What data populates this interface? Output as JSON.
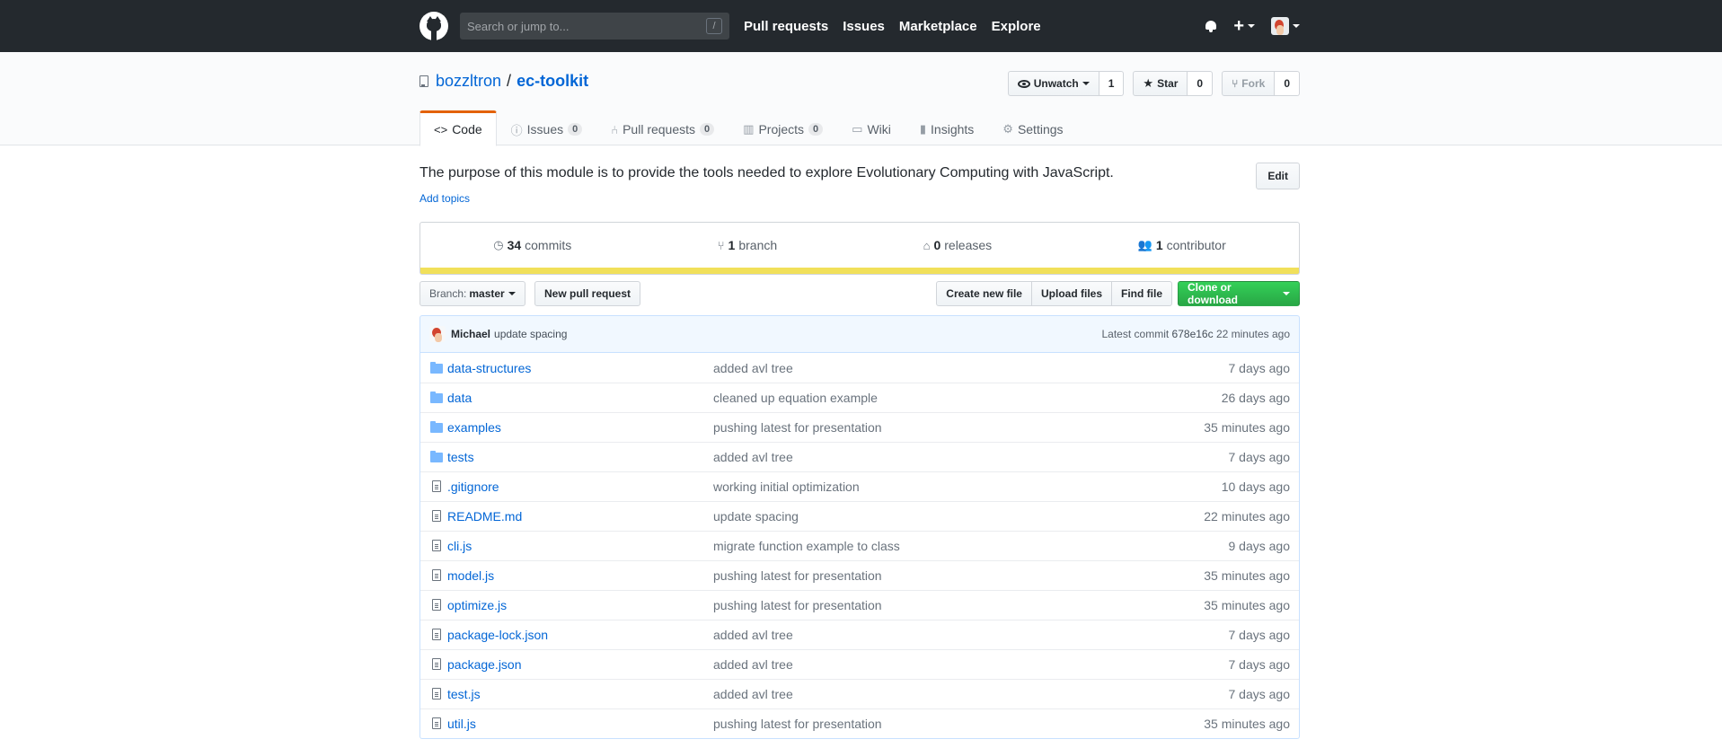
{
  "header": {
    "search_placeholder": "Search or jump to...",
    "search_shortcut": "/",
    "nav": [
      "Pull requests",
      "Issues",
      "Marketplace",
      "Explore"
    ],
    "plus_label": "+"
  },
  "repo": {
    "owner": "bozzltron",
    "separator": "/",
    "name": "ec-toolkit",
    "watch_label": "Unwatch",
    "watch_count": "1",
    "star_label": "Star",
    "star_count": "0",
    "fork_label": "Fork",
    "fork_count": "0"
  },
  "tabs": [
    {
      "label": "Code",
      "icon": "<>"
    },
    {
      "label": "Issues",
      "count": "0",
      "icon": "issue-icon"
    },
    {
      "label": "Pull requests",
      "count": "0",
      "icon": "pr-icon"
    },
    {
      "label": "Projects",
      "count": "0",
      "icon": "project-icon"
    },
    {
      "label": "Wiki",
      "icon": "book-icon"
    },
    {
      "label": "Insights",
      "icon": "graph-icon"
    },
    {
      "label": "Settings",
      "icon": "gear-icon"
    }
  ],
  "about": {
    "description": "The purpose of this module is to provide the tools needed to explore Evolutionary Computing with JavaScript.",
    "edit_label": "Edit",
    "add_topics": "Add topics"
  },
  "summary": {
    "commits_count": "34",
    "commits_label": "commits",
    "branch_count": "1",
    "branch_label": "branch",
    "releases_count": "0",
    "releases_label": "releases",
    "contributor_count": "1",
    "contributor_label": "contributor"
  },
  "language_color": "#f1e05a",
  "file_nav": {
    "branch_prefix": "Branch:",
    "branch_name": "master",
    "new_pr": "New pull request",
    "create_file": "Create new file",
    "upload_files": "Upload files",
    "find_file": "Find file",
    "clone": "Clone or download"
  },
  "latest_commit": {
    "author": "Michael",
    "message": "update spacing",
    "prefix": "Latest commit",
    "sha": "678e16c",
    "age": "22 minutes ago"
  },
  "files": [
    {
      "type": "dir",
      "name": "data-structures",
      "message": "added avl tree",
      "age": "7 days ago"
    },
    {
      "type": "dir",
      "name": "data",
      "message": "cleaned up equation example",
      "age": "26 days ago"
    },
    {
      "type": "dir",
      "name": "examples",
      "message": "pushing latest for presentation",
      "age": "35 minutes ago"
    },
    {
      "type": "dir",
      "name": "tests",
      "message": "added avl tree",
      "age": "7 days ago"
    },
    {
      "type": "file",
      "name": ".gitignore",
      "message": "working initial optimization",
      "age": "10 days ago"
    },
    {
      "type": "file",
      "name": "README.md",
      "message": "update spacing",
      "age": "22 minutes ago"
    },
    {
      "type": "file",
      "name": "cli.js",
      "message": "migrate function example to class",
      "age": "9 days ago"
    },
    {
      "type": "file",
      "name": "model.js",
      "message": "pushing latest for presentation",
      "age": "35 minutes ago"
    },
    {
      "type": "file",
      "name": "optimize.js",
      "message": "pushing latest for presentation",
      "age": "35 minutes ago"
    },
    {
      "type": "file",
      "name": "package-lock.json",
      "message": "added avl tree",
      "age": "7 days ago"
    },
    {
      "type": "file",
      "name": "package.json",
      "message": "added avl tree",
      "age": "7 days ago"
    },
    {
      "type": "file",
      "name": "test.js",
      "message": "added avl tree",
      "age": "7 days ago"
    },
    {
      "type": "file",
      "name": "util.js",
      "message": "pushing latest for presentation",
      "age": "35 minutes ago"
    }
  ]
}
